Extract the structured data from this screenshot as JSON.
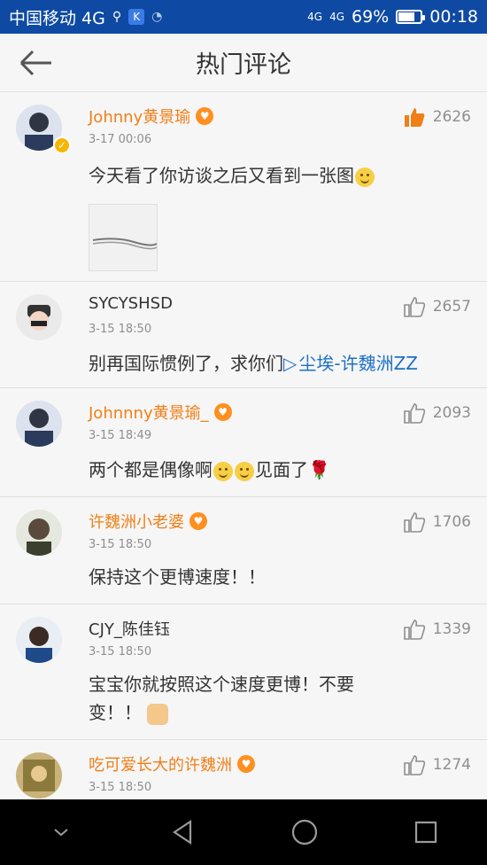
{
  "status_bar": {
    "carrier": "中国移动 4G",
    "network_1": "4G",
    "network_2": "4G",
    "battery": "69%",
    "time": "00:18",
    "badge": "K"
  },
  "header": {
    "title": "热门评论"
  },
  "comments": [
    {
      "name": "Johnny黄景瑜",
      "time": "3-17 00:06",
      "likes": "2626",
      "text": "今天看了你访谈之后又看到一张图",
      "liked": true
    },
    {
      "name": "SYCYSHSD",
      "time": "3-15 18:50",
      "likes": "2657",
      "text": "别再国际惯例了，求你们",
      "link": "尘埃-许魏洲ZZ"
    },
    {
      "name": "Johnnny黄景瑜_",
      "time": "3-15 18:49",
      "likes": "2093",
      "text_a": "两个都是偶像啊",
      "text_b": "见面了"
    },
    {
      "name": "许魏洲小老婆",
      "time": "3-15 18:50",
      "likes": "1706",
      "text": "保持这个更博速度！！"
    },
    {
      "name": "CJY_陈佳钰",
      "time": "3-15 18:50",
      "likes": "1339",
      "text_line1": "宝宝你就按照这个速度更博！不要",
      "text_line2": "变！！"
    },
    {
      "name": "吃可爱长大的许魏洲",
      "time": "3-15 18:50",
      "likes": "1274"
    }
  ],
  "colors": {
    "status_bar_bg": "#0e4aa3",
    "orange_name": "#f07f17",
    "link_blue": "#1c70c5",
    "like_active": "#f07f17"
  }
}
